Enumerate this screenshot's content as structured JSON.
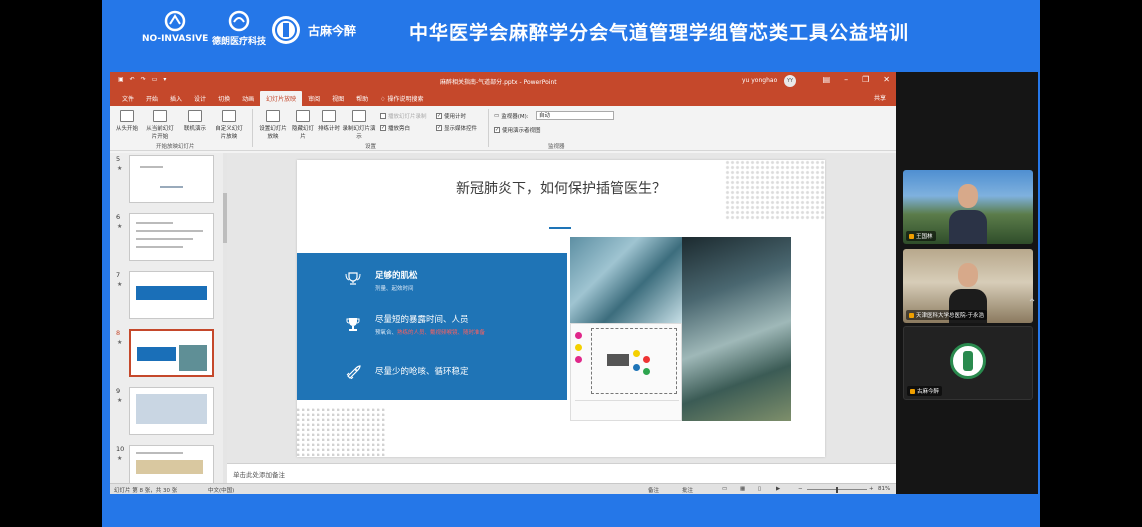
{
  "banner": {
    "logos": [
      "NO-INVASIVE",
      "德朗医疗科技",
      "古麻今醉"
    ],
    "title": "中华医学会麻醉学分会气道管理学组管芯类工具公益培训"
  },
  "ppt": {
    "window_title": "麻醉相关指南-气道部分.pptx - PowerPoint",
    "user": "yu yonghao",
    "avatar": "YY",
    "tabs": [
      "文件",
      "开始",
      "插入",
      "设计",
      "切换",
      "动画",
      "幻灯片放映",
      "审阅",
      "视图",
      "帮助"
    ],
    "active_tab": "幻灯片放映",
    "tell_me": "操作说明搜索",
    "share": "共享",
    "ribbon": {
      "from_beginning": "从头开始",
      "from_current": "从当前幻灯片开始",
      "online": "联机演示",
      "custom": "自定义幻灯片放映",
      "group1": "开始放映幻灯片",
      "setup": "设置幻灯片放映",
      "hide": "隐藏幻灯片",
      "rehearse": "排练计时",
      "record": "录制幻灯片演示",
      "play_narrations": "播放旁白",
      "use_timings": "使用计时",
      "show_media": "显示媒体控件",
      "group2": "设置",
      "monitor_label": "监视器(M):",
      "monitor_value": "自动",
      "presenter_view": "使用演示者视图",
      "group3": "监视器"
    },
    "thumbnails": [
      {
        "num": "5",
        "star": "★"
      },
      {
        "num": "6",
        "star": "★"
      },
      {
        "num": "7",
        "star": "★"
      },
      {
        "num": "8",
        "star": "★"
      },
      {
        "num": "9",
        "star": "★"
      },
      {
        "num": "10",
        "star": "★"
      }
    ],
    "selected_slide": 8,
    "slide": {
      "title": "新冠肺炎下，如何保护插管医生？",
      "points": [
        {
          "title": "足够的肌松",
          "sub": "剂量、起效时间"
        },
        {
          "title": "尽量短的暴露时间、人员",
          "sub": "预氧合、",
          "sub_red": "熟练的人员、戴视频喉镜、随时准备"
        },
        {
          "title": "尽量少的呛咳、循环稳定",
          "sub": ""
        }
      ]
    },
    "notes_placeholder": "单击此处添加备注",
    "status": {
      "slide_pos": "幻灯片 第 8 张，共 30 张",
      "language": "中文(中国)",
      "notes": "备注",
      "comments": "批注",
      "zoom": "81%"
    }
  },
  "videos": [
    {
      "name": "王国林"
    },
    {
      "name": "天津医科大学总医院-于永浩"
    },
    {
      "name": "古麻今醉"
    }
  ],
  "colors": {
    "frame_blue": "#2577e8",
    "ppt_accent": "#c5482b",
    "slide_blue": "#1f74b6"
  }
}
